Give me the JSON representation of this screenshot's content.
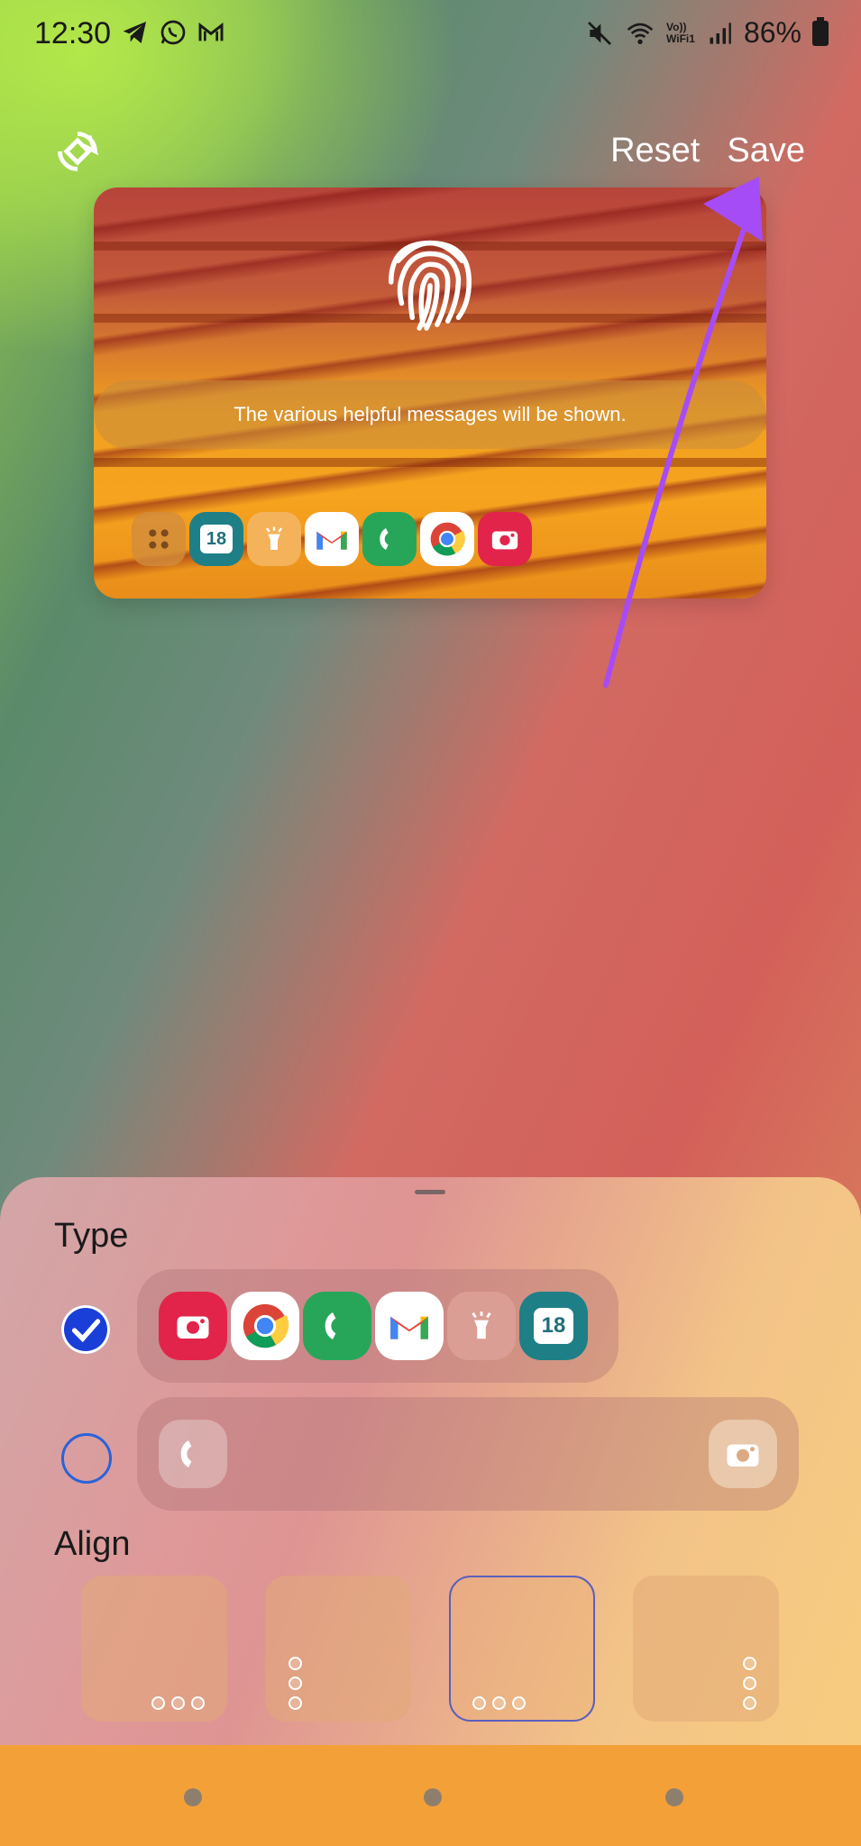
{
  "status_bar": {
    "time": "12:30",
    "left_icons": [
      "telegram-icon",
      "whatsapp-icon",
      "mail-icon"
    ],
    "right_icons": [
      "mute-icon",
      "wifi-icon",
      "volte-icon",
      "signal-icon",
      "battery-icon"
    ],
    "volte_label_top": "Vo))",
    "volte_label_bottom": "WiFi1",
    "battery": "86%"
  },
  "toolbar": {
    "reset_label": "Reset",
    "save_label": "Save"
  },
  "preview": {
    "message": "The various helpful messages will be shown.",
    "shortcuts": [
      "apps-icon",
      "calendar-icon",
      "flashlight-icon",
      "gmail-icon",
      "phone-icon",
      "chrome-icon",
      "camera-icon"
    ],
    "calendar_day": "18"
  },
  "sheet": {
    "type_label": "Type",
    "align_label": "Align",
    "type_option_1": {
      "selected": true,
      "apps": [
        "camera-icon",
        "chrome-icon",
        "phone-icon",
        "gmail-icon",
        "flashlight-icon",
        "calendar-icon"
      ],
      "calendar_day": "18"
    },
    "type_option_2": {
      "selected": false,
      "left_app": "phone-icon",
      "right_app": "camera-icon"
    },
    "align_options": [
      "bottom-left",
      "left-vertical",
      "bottom-center",
      "right-vertical"
    ],
    "align_selected": "bottom-center"
  },
  "colors": {
    "accent_arrow": "#a64cf6",
    "radio_selected": "#1a3fd9",
    "nav_bar": "#f4a039"
  }
}
